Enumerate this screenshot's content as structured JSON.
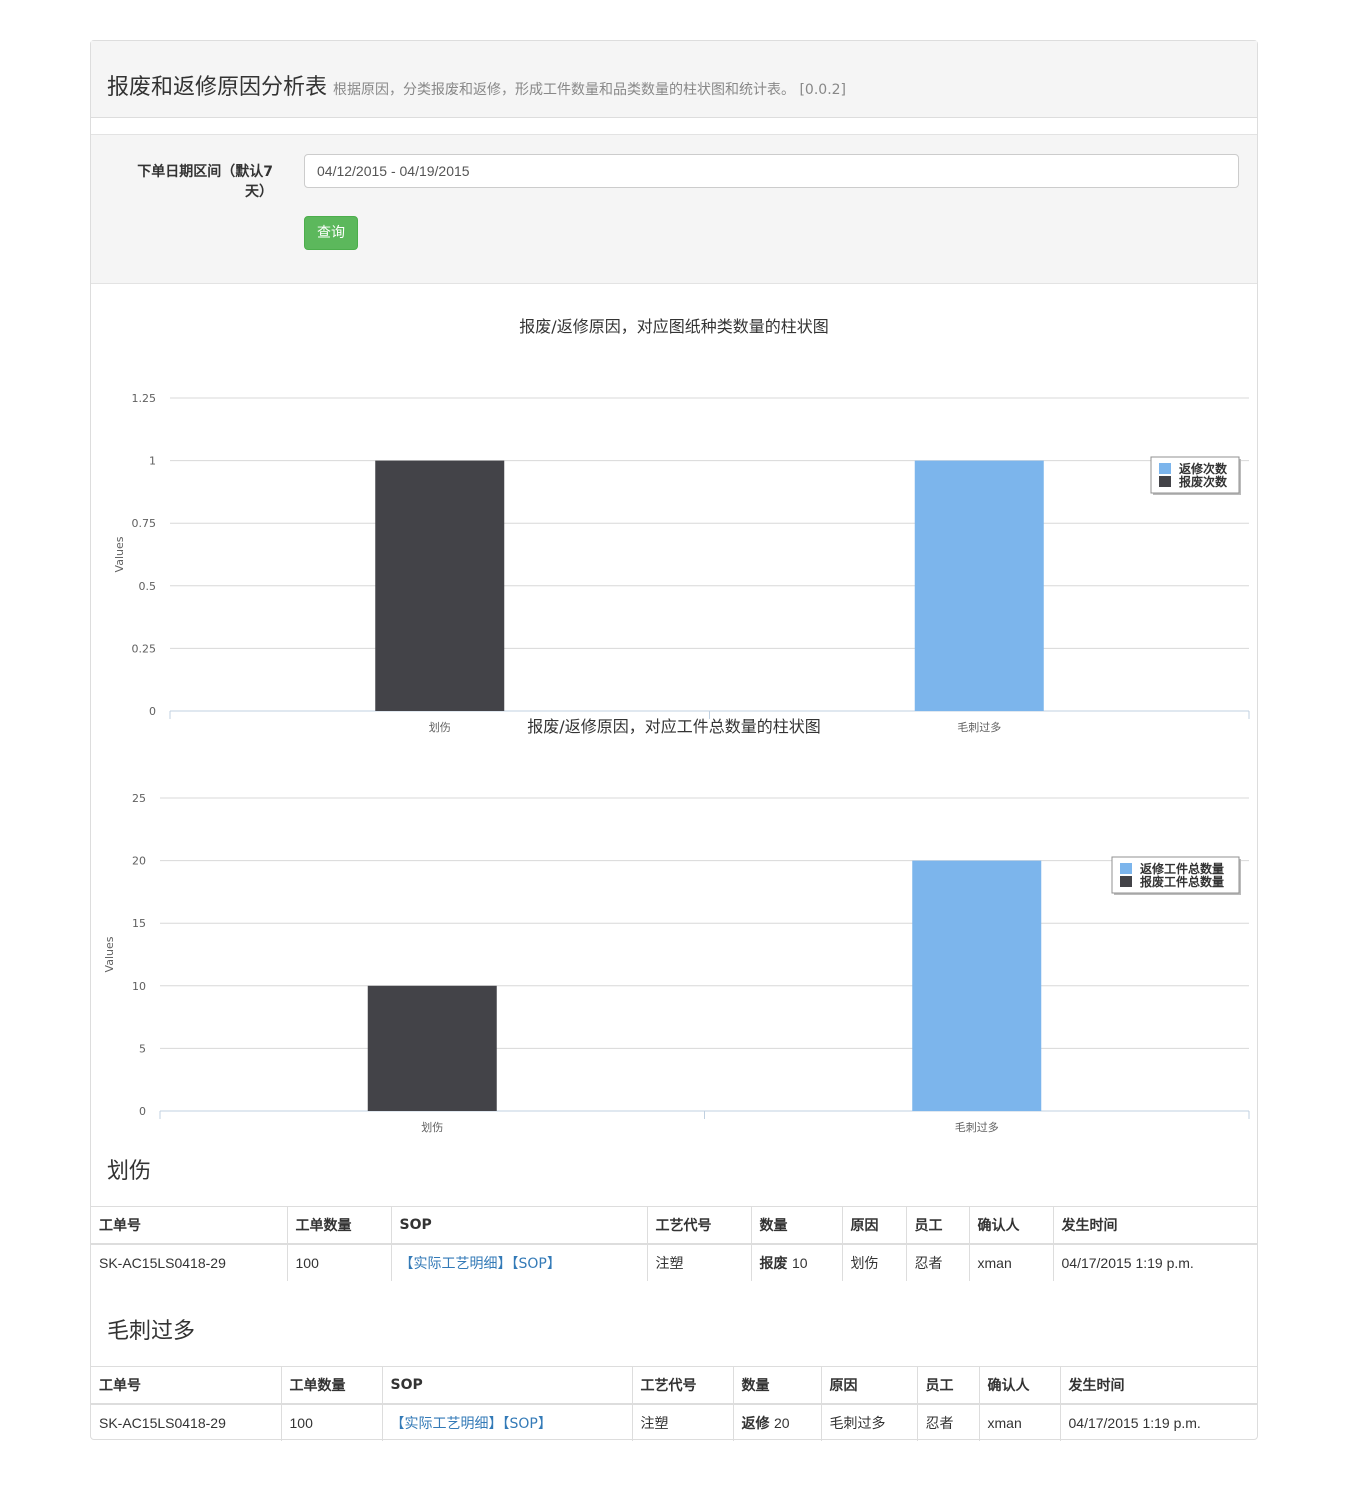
{
  "header": {
    "title": "报废和返修原因分析表",
    "subtitle": "根据原因，分类报废和返修，形成工件数量和品类数量的柱状图和统计表。 [0.0.2]"
  },
  "form": {
    "date_label": "下单日期区间（默认7天）",
    "date_value": "04/12/2015 - 04/19/2015",
    "query_button": "查询"
  },
  "chart_data": [
    {
      "type": "bar",
      "title": "报废/返修原因，对应图纸种类数量的柱状图",
      "ylabel": "Values",
      "ylim": [
        0,
        1.25
      ],
      "yticks": [
        "0",
        "0.25",
        "0.5",
        "0.75",
        "1",
        "1.25"
      ],
      "categories": [
        "划伤",
        "毛刺过多"
      ],
      "series": [
        {
          "name": "返修次数",
          "color": "#7cb5ec",
          "values": [
            0,
            1
          ]
        },
        {
          "name": "报废次数",
          "color": "#434348",
          "values": [
            1,
            0
          ]
        }
      ],
      "legend": "right"
    },
    {
      "type": "bar",
      "title": "报废/返修原因，对应工件总数量的柱状图",
      "ylabel": "Values",
      "ylim": [
        0,
        25
      ],
      "yticks": [
        "0",
        "5",
        "10",
        "15",
        "20",
        "25"
      ],
      "categories": [
        "划伤",
        "毛刺过多"
      ],
      "series": [
        {
          "name": "返修工件总数量",
          "color": "#7cb5ec",
          "values": [
            0,
            20
          ]
        },
        {
          "name": "报废工件总数量",
          "color": "#434348",
          "values": [
            10,
            0
          ]
        }
      ],
      "legend": "right"
    }
  ],
  "tables": [
    {
      "title": "划伤",
      "headers": [
        "工单号",
        "工单数量",
        "SOP",
        "工艺代号",
        "数量",
        "原因",
        "员工",
        "确认人",
        "发生时间"
      ],
      "row": {
        "order_no": "SK-AC15LS0418-29",
        "order_qty": "100",
        "sop_detail": "【实际工艺明细】",
        "sop_link": "【SOP】",
        "process_code": "注塑",
        "qty_type": "报废",
        "qty_value": "10",
        "reason": "划伤",
        "employee": "忍者",
        "confirmer": "xman",
        "time": "04/17/2015 1:19 p.m."
      }
    },
    {
      "title": "毛刺过多",
      "headers": [
        "工单号",
        "工单数量",
        "SOP",
        "工艺代号",
        "数量",
        "原因",
        "员工",
        "确认人",
        "发生时间"
      ],
      "row": {
        "order_no": "SK-AC15LS0418-29",
        "order_qty": "100",
        "sop_detail": "【实际工艺明细】",
        "sop_link": "【SOP】",
        "process_code": "注塑",
        "qty_type": "返修",
        "qty_value": "20",
        "reason": "毛刺过多",
        "employee": "忍者",
        "confirmer": "xman",
        "time": "04/17/2015 1:19 p.m."
      }
    }
  ]
}
